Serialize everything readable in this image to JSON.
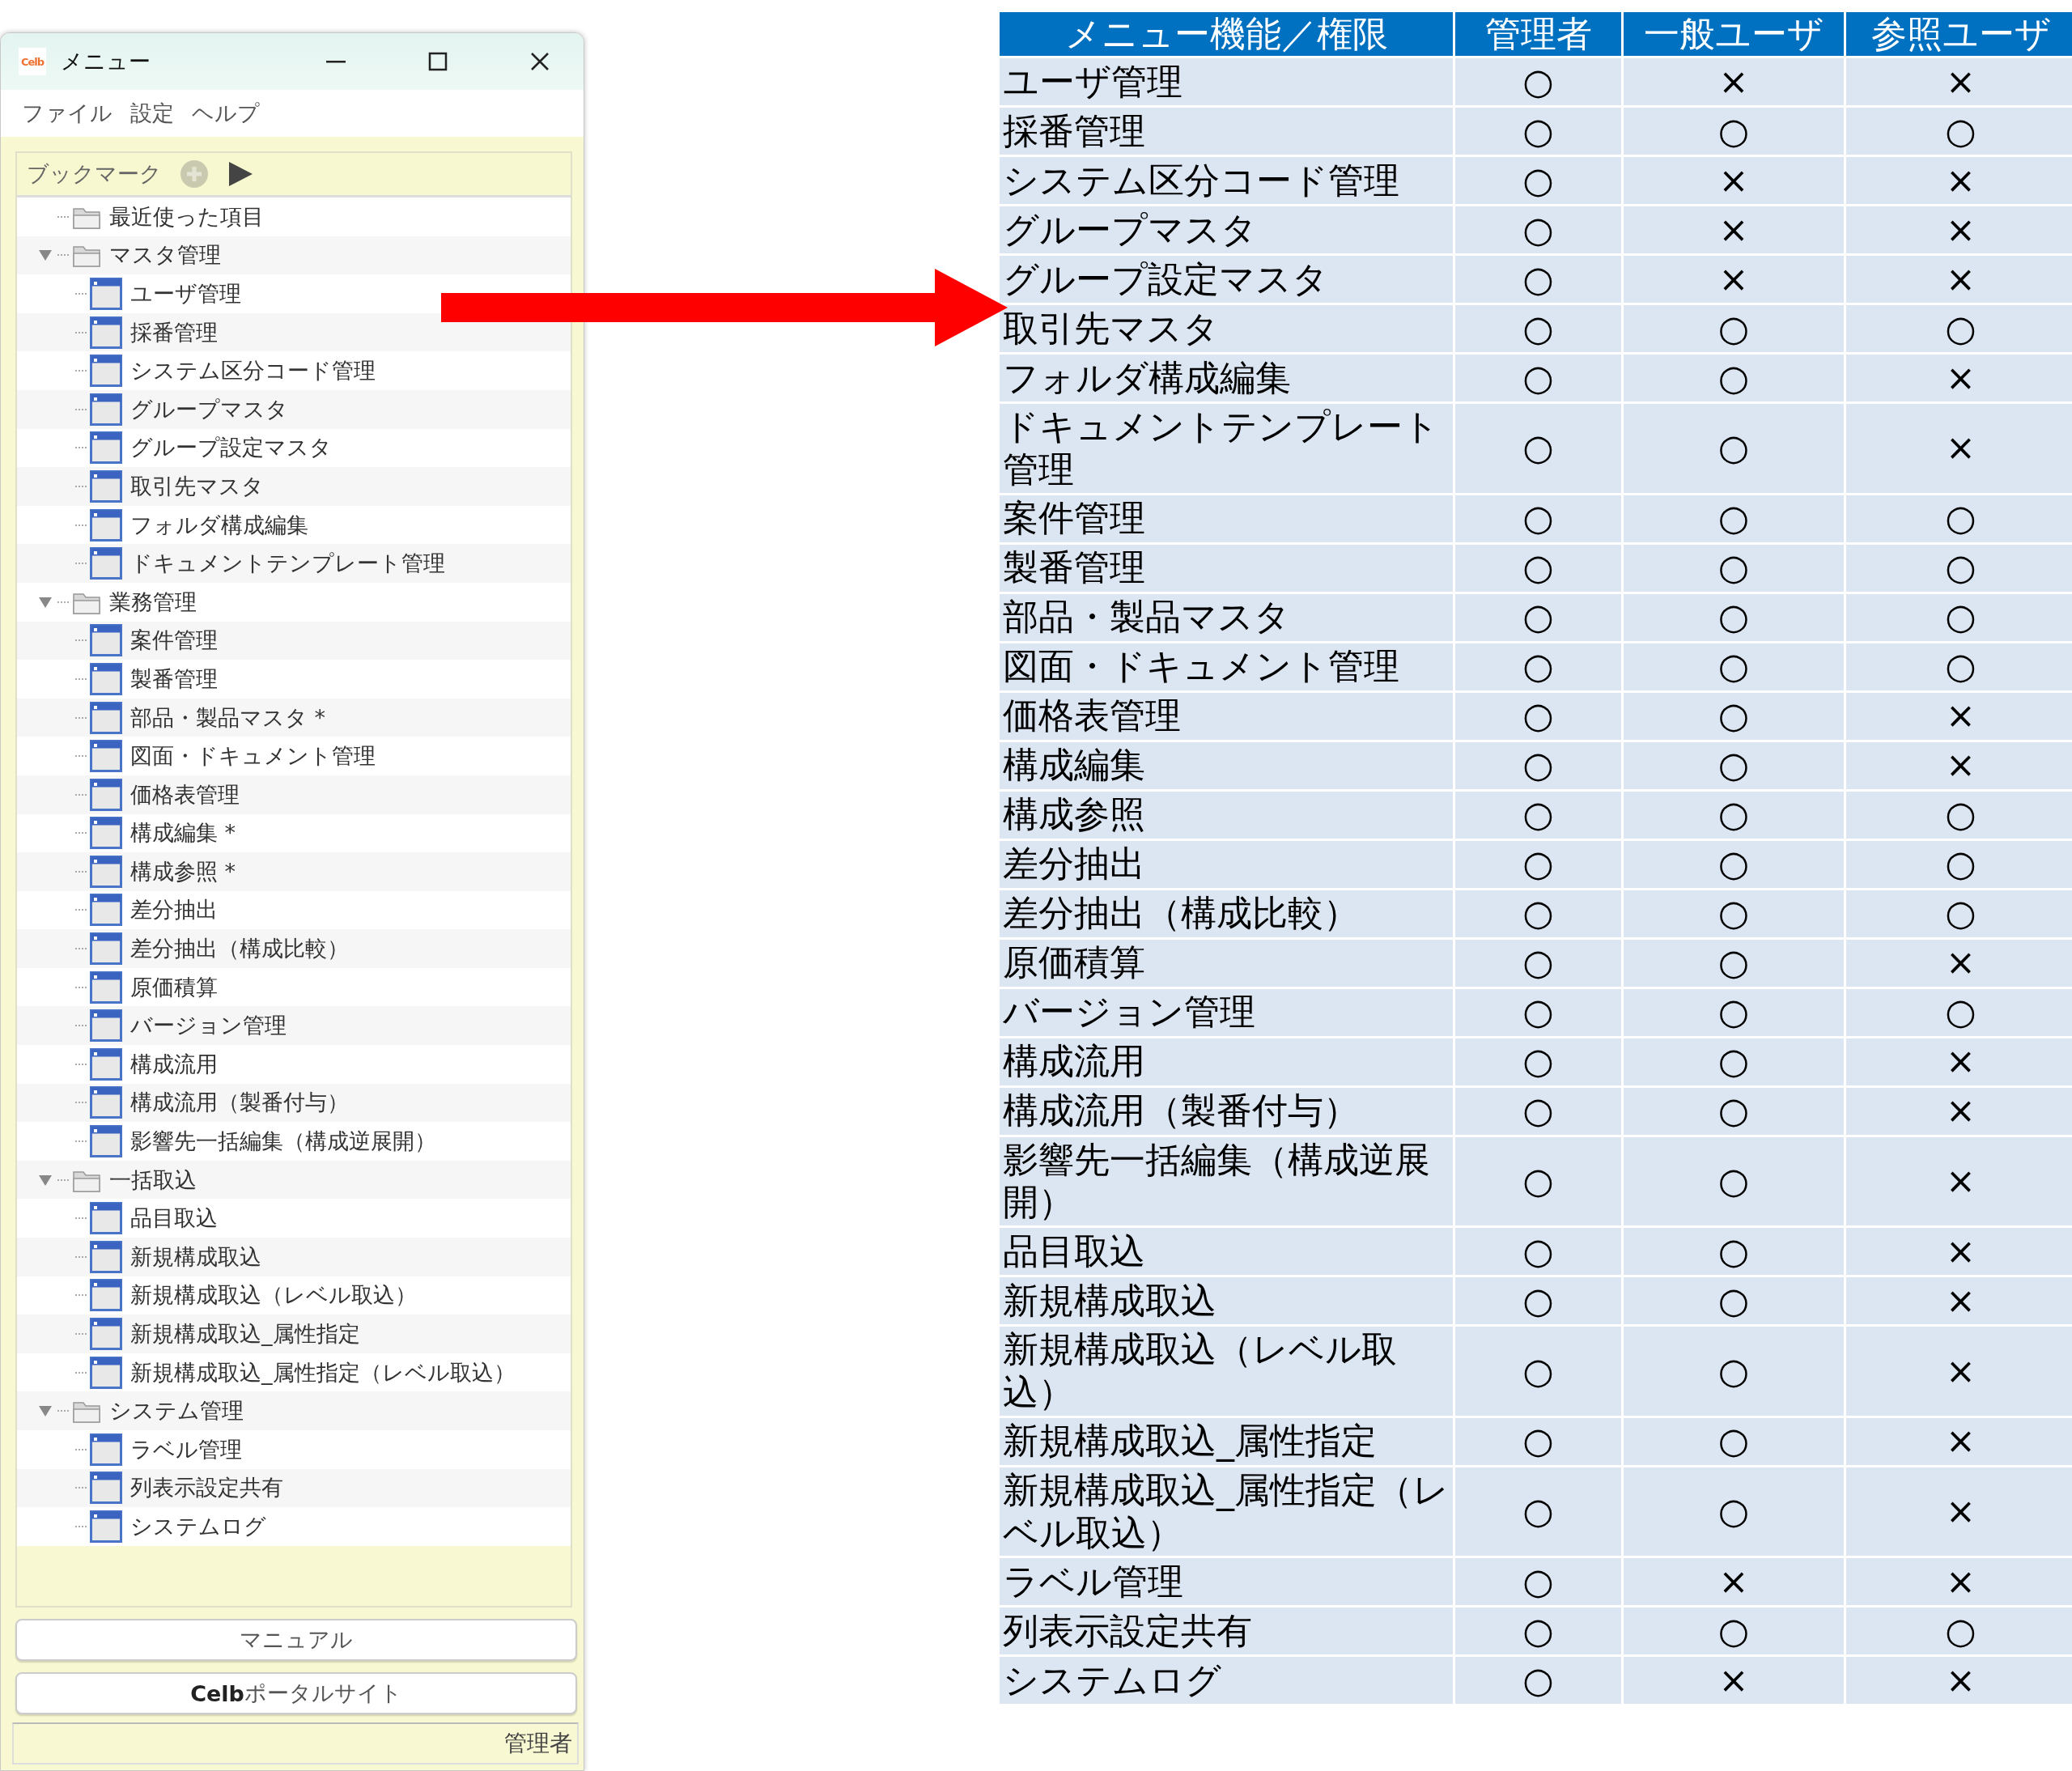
{
  "window": {
    "logo": "Celb",
    "title": "メニュー",
    "menu": [
      "ファイル",
      "設定",
      "ヘルプ"
    ],
    "bookmark_bar": {
      "label": "ブックマーク"
    },
    "tree": [
      {
        "label": "最近使った項目",
        "kind": "folder"
      },
      {
        "label": "マスタ管理",
        "kind": "folder",
        "expanded": true,
        "children": [
          {
            "label": "ユーザ管理",
            "kind": "screen"
          },
          {
            "label": "採番管理",
            "kind": "screen"
          },
          {
            "label": "システム区分コード管理",
            "kind": "screen"
          },
          {
            "label": "グループマスタ",
            "kind": "screen"
          },
          {
            "label": "グループ設定マスタ",
            "kind": "screen"
          },
          {
            "label": "取引先マスタ",
            "kind": "screen"
          },
          {
            "label": "フォルダ構成編集",
            "kind": "screen"
          },
          {
            "label": "ドキュメントテンプレート管理",
            "kind": "screen"
          }
        ]
      },
      {
        "label": "業務管理",
        "kind": "folder",
        "expanded": true,
        "children": [
          {
            "label": "案件管理",
            "kind": "screen"
          },
          {
            "label": "製番管理",
            "kind": "screen"
          },
          {
            "label": "部品・製品マスタ *",
            "kind": "screen"
          },
          {
            "label": "図面・ドキュメント管理",
            "kind": "screen"
          },
          {
            "label": "価格表管理",
            "kind": "screen"
          },
          {
            "label": "構成編集 *",
            "kind": "screen"
          },
          {
            "label": "構成参照 *",
            "kind": "screen"
          },
          {
            "label": "差分抽出",
            "kind": "screen"
          },
          {
            "label": "差分抽出（構成比較）",
            "kind": "screen"
          },
          {
            "label": "原価積算",
            "kind": "screen"
          },
          {
            "label": "バージョン管理",
            "kind": "screen"
          },
          {
            "label": "構成流用",
            "kind": "screen"
          },
          {
            "label": "構成流用（製番付与）",
            "kind": "screen"
          },
          {
            "label": "影響先一括編集（構成逆展開）",
            "kind": "screen"
          }
        ]
      },
      {
        "label": "一括取込",
        "kind": "folder",
        "expanded": true,
        "children": [
          {
            "label": "品目取込",
            "kind": "screen"
          },
          {
            "label": "新規構成取込",
            "kind": "screen"
          },
          {
            "label": "新規構成取込（レベル取込）",
            "kind": "screen"
          },
          {
            "label": "新規構成取込_属性指定",
            "kind": "screen"
          },
          {
            "label": "新規構成取込_属性指定（レベル取込）",
            "kind": "screen"
          }
        ]
      },
      {
        "label": "システム管理",
        "kind": "folder",
        "expanded": true,
        "children": [
          {
            "label": "ラベル管理",
            "kind": "screen"
          },
          {
            "label": "列表示設定共有",
            "kind": "screen"
          },
          {
            "label": "システムログ",
            "kind": "screen"
          }
        ]
      }
    ],
    "buttons": [
      "マニュアル",
      "**Celb**ポータルサイト"
    ],
    "status_bar": "管理者"
  },
  "table": {
    "columns": [
      "メニュー機能／権限",
      "管理者",
      "一般ユーザ",
      "参照ユーザ"
    ],
    "rows": [
      {
        "cells": [
          "ユーザ管理",
          "○",
          "×",
          "×"
        ]
      },
      {
        "cells": [
          "採番管理",
          "○",
          "○",
          "○"
        ]
      },
      {
        "cells": [
          "システム区分コード管理",
          "○",
          "×",
          "×"
        ]
      },
      {
        "cells": [
          "グループマスタ",
          "○",
          "×",
          "×"
        ]
      },
      {
        "cells": [
          "グループ設定マスタ",
          "○",
          "×",
          "×"
        ]
      },
      {
        "cells": [
          "取引先マスタ",
          "○",
          "○",
          "○"
        ]
      },
      {
        "cells": [
          "フォルダ構成編集",
          "○",
          "○",
          "×"
        ]
      },
      {
        "cells": [
          "ドキュメントテンプレート管理",
          "○",
          "○",
          "×"
        ]
      },
      {
        "cells": [
          "案件管理",
          "○",
          "○",
          "○"
        ]
      },
      {
        "cells": [
          "製番管理",
          "○",
          "○",
          "○"
        ]
      },
      {
        "cells": [
          "部品・製品マスタ",
          "○",
          "○",
          "○"
        ]
      },
      {
        "cells": [
          "図面・ドキュメント管理",
          "○",
          "○",
          "○"
        ]
      },
      {
        "cells": [
          "価格表管理",
          "○",
          "○",
          "×"
        ]
      },
      {
        "cells": [
          "構成編集",
          "○",
          "○",
          "×"
        ]
      },
      {
        "cells": [
          "構成参照",
          "○",
          "○",
          "○"
        ]
      },
      {
        "cells": [
          "差分抽出",
          "○",
          "○",
          "○"
        ]
      },
      {
        "cells": [
          "差分抽出（構成比較）",
          "○",
          "○",
          "○"
        ]
      },
      {
        "cells": [
          "原価積算",
          "○",
          "○",
          "×"
        ]
      },
      {
        "cells": [
          "バージョン管理",
          "○",
          "○",
          "○"
        ]
      },
      {
        "cells": [
          "構成流用",
          "○",
          "○",
          "×"
        ]
      },
      {
        "cells": [
          "構成流用（製番付与）",
          "○",
          "○",
          "×"
        ]
      },
      {
        "cells": [
          "影響先一括編集（構成逆展開）",
          "○",
          "○",
          "×"
        ]
      },
      {
        "cells": [
          "品目取込",
          "○",
          "○",
          "×"
        ]
      },
      {
        "cells": [
          "新規構成取込",
          "○",
          "○",
          "×"
        ]
      },
      {
        "cells": [
          "新規構成取込（レベル取込）",
          "○",
          "○",
          "×"
        ]
      },
      {
        "cells": [
          "新規構成取込_属性指定",
          "○",
          "○",
          "×"
        ]
      },
      {
        "cells": [
          "新規構成取込_属性指定（レベル取込）",
          "○",
          "○",
          "×"
        ]
      },
      {
        "cells": [
          "ラベル管理",
          "○",
          "×",
          "×"
        ]
      },
      {
        "cells": [
          "列表示設定共有",
          "○",
          "○",
          "○"
        ]
      },
      {
        "cells": [
          "システムログ",
          "○",
          "×",
          "×"
        ]
      }
    ]
  }
}
